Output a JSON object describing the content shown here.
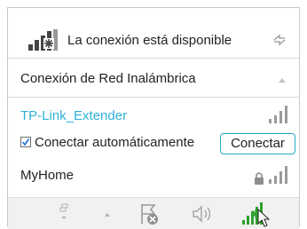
{
  "header": {
    "status_text": "La conexión está disponible",
    "status_icon": "network-available-icon",
    "refresh_icon": "refresh-icon"
  },
  "section": {
    "title": "Conexión de Red Inalámbrica",
    "collapse_icon": "collapse-up-icon"
  },
  "networks": [
    {
      "ssid": "TP-Link_Extender",
      "selected": true,
      "auto_connect_label": "Conectar automáticamente",
      "auto_connect_checked": true,
      "connect_label": "Conectar",
      "secured": false,
      "signal_bars": 4
    },
    {
      "ssid": "MyHome",
      "secured": true,
      "signal_bars": 4
    }
  ],
  "taskbar": {
    "icons": [
      "show-desktop-icon",
      "show-hidden-icons-arrow",
      "action-center-icon",
      "volume-icon",
      "network-tray-icon",
      "mouse-cursor-icon"
    ]
  },
  "colors": {
    "accent": "#2fb1d8",
    "text": "#222222",
    "icon": "#8c8c8c",
    "green": "#2ea12e"
  }
}
